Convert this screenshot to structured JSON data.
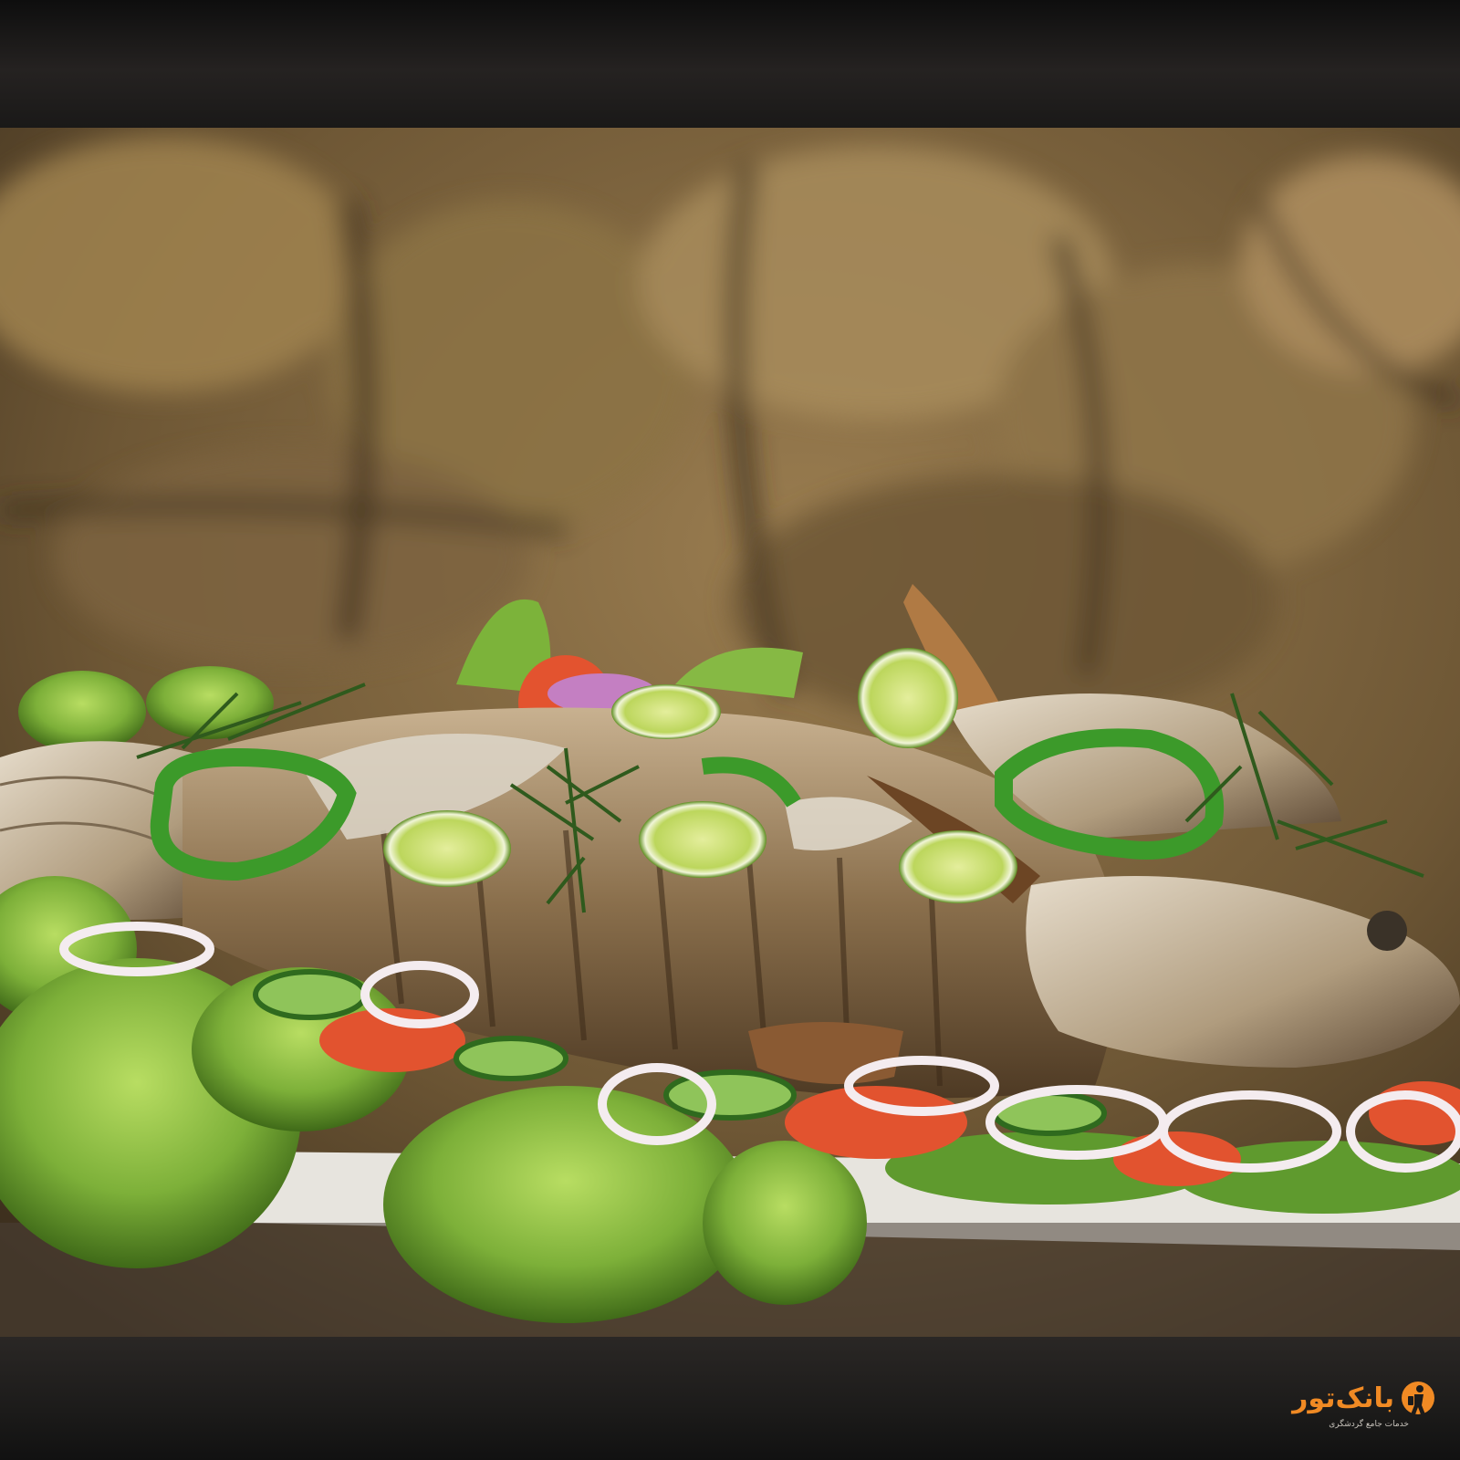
{
  "photo": {
    "subject": "grilled-whole-fish-platter",
    "palette": {
      "stone_wall": "#8a7048",
      "lettuce": "#7fb23a",
      "lime": "#b8d458",
      "pepper": "#3c9a2a",
      "tomato": "#e2532f",
      "onion": "#f1e6ef",
      "fish_skin": "#b5a07e",
      "band": "#1b1b1b"
    }
  },
  "watermark": {
    "name": "بانک‌تور",
    "tagline": "خدمات جامع گردشگری",
    "icon": "traveler-icon",
    "color": "#f08a24"
  }
}
